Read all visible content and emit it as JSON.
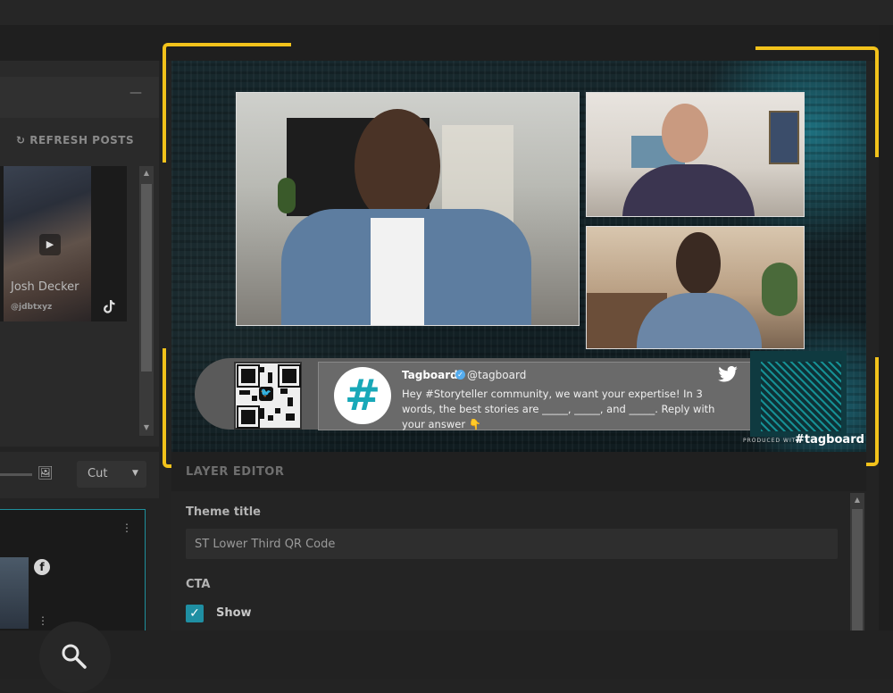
{
  "left_panel": {
    "refresh_label": "↻ REFRESH POSTS",
    "collapse_glyph": "—",
    "post": {
      "name": "Josh Decker",
      "handle": "@jdbtxyz",
      "platform_icon": "tiktok-icon",
      "play_glyph": "▶"
    }
  },
  "preview": {
    "tweet": {
      "author": "Tagboard",
      "handle": "@tagboard",
      "verified_glyph": "✓",
      "avatar_glyph": "#",
      "text": "Hey #Storyteller community, we want your expertise! In 3 words, the best stories are _____, _____, and _____. Reply with your answer 👇",
      "bird_glyph": "🐦"
    },
    "qr_bird_glyph": "🐦",
    "produced_with": "PRODUCED WITH",
    "brand": "#tagboard"
  },
  "controls": {
    "image_glyph": "🖼",
    "transition": "Cut",
    "caret": "▼",
    "kebab": "⋮",
    "fb_glyph": "f"
  },
  "layer_editor": {
    "title": "LAYER EDITOR",
    "theme_title_label": "Theme title",
    "theme_title_value": "ST Lower Third QR Code",
    "cta_label": "CTA",
    "cta_show_label": "Show",
    "cta_checked_glyph": "✓"
  },
  "colors": {
    "highlight": "#f2c21b",
    "accent": "#1f8fa3",
    "twitter": "#55acee"
  }
}
